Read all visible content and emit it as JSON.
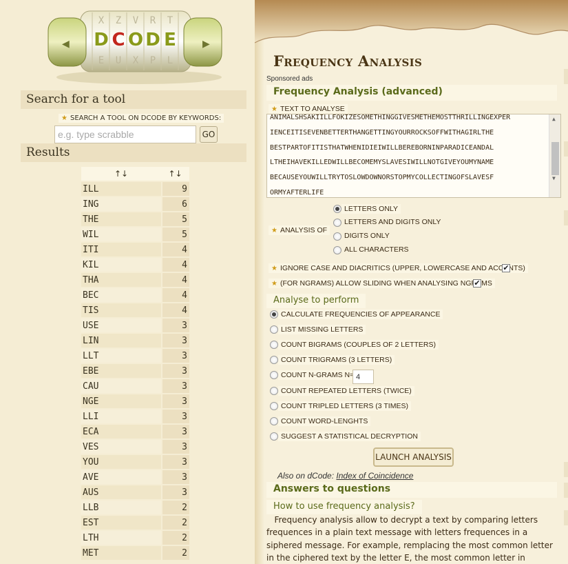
{
  "logo": {
    "name": "DCODE",
    "letters": [
      "D",
      "C",
      "O",
      "D",
      "E"
    ]
  },
  "sidebar": {
    "search_heading": "Search for a tool",
    "search_label": "SEARCH A TOOL ON DCODE BY KEYWORDS:",
    "search_placeholder": "e.g. type scrabble",
    "go_label": "GO",
    "results_heading": "Results",
    "sort_glyph": "↑↓",
    "rows": [
      {
        "ngram": "ILL",
        "count": "9"
      },
      {
        "ngram": "ING",
        "count": "6"
      },
      {
        "ngram": "THE",
        "count": "5"
      },
      {
        "ngram": "WIL",
        "count": "5"
      },
      {
        "ngram": "ITI",
        "count": "4"
      },
      {
        "ngram": "KIL",
        "count": "4"
      },
      {
        "ngram": "THA",
        "count": "4"
      },
      {
        "ngram": "BEC",
        "count": "4"
      },
      {
        "ngram": "TIS",
        "count": "4"
      },
      {
        "ngram": "USE",
        "count": "3"
      },
      {
        "ngram": "LIN",
        "count": "3"
      },
      {
        "ngram": "LLT",
        "count": "3"
      },
      {
        "ngram": "EBE",
        "count": "3"
      },
      {
        "ngram": "CAU",
        "count": "3"
      },
      {
        "ngram": "NGE",
        "count": "3"
      },
      {
        "ngram": "LLI",
        "count": "3"
      },
      {
        "ngram": "ECA",
        "count": "3"
      },
      {
        "ngram": "VES",
        "count": "3"
      },
      {
        "ngram": "YOU",
        "count": "3"
      },
      {
        "ngram": "AVE",
        "count": "3"
      },
      {
        "ngram": "AUS",
        "count": "3"
      },
      {
        "ngram": "LLB",
        "count": "2"
      },
      {
        "ngram": "EST",
        "count": "2"
      },
      {
        "ngram": "LTH",
        "count": "2"
      },
      {
        "ngram": "MET",
        "count": "2"
      }
    ]
  },
  "main": {
    "title": "Frequency Analysis",
    "sponsored": "Sponsored ads",
    "tool_heading": "Frequency Analysis (advanced)",
    "text_label": "TEXT TO ANALYSE",
    "text_lines": [
      "ANIMALSHSAKIILLFOKIZESOMETHINGGIVESMETHEMOSTTHRILLINGEXPER",
      "IENCEITISEVENBETTERTHANGETTINGYOURROCKSOFFWITHAGIRLTHE",
      "BESTPARTOFITISTHATWHENIDIEIWILLBEREBORNINPARADICEANDAL",
      "LTHEIHAVEKILLEDWILLBECOMEMYSLAVESIWILLNOTGIVEYOUMYNAME",
      "BECAUSEYOUWILLTRYTOSLOWDOWNORSTOPMYCOLLECTINGOFSLAVESF",
      "ORMYAFTERLIFE"
    ],
    "analysis_of_label": "ANALYSIS OF",
    "analysis_options": [
      {
        "label": "LETTERS ONLY",
        "selected": true
      },
      {
        "label": "LETTERS AND DIGITS ONLY",
        "selected": false
      },
      {
        "label": "DIGITS ONLY",
        "selected": false
      },
      {
        "label": "ALL CHARACTERS",
        "selected": false
      }
    ],
    "ignore_case_label": "IGNORE CASE AND DIACRITICS (UPPER, LOWERCASE AND ACCENTS)",
    "sliding_label": "(FOR NGRAMS) ALLOW SLIDING WHEN ANALYSING NGRAMS",
    "check_glyph": "✔",
    "analyse_heading": "Analyse to perform",
    "perform_options": [
      {
        "label": "CALCULATE FREQUENCIES OF APPEARANCE",
        "selected": true
      },
      {
        "label": "LIST MISSING LETTERS",
        "selected": false
      },
      {
        "label": "COUNT BIGRAMS (COUPLES OF 2 LETTERS)",
        "selected": false
      },
      {
        "label": "COUNT TRIGRAMS (3 LETTERS)",
        "selected": false
      },
      {
        "label": "COUNT N-GRAMS N=",
        "selected": false
      },
      {
        "label": "COUNT REPEATED LETTERS (TWICE)",
        "selected": false
      },
      {
        "label": "COUNT TRIPLED LETTERS (3 TIMES)",
        "selected": false
      },
      {
        "label": "COUNT WORD-LENGHTS",
        "selected": false
      },
      {
        "label": "SUGGEST A STATISTICAL DECRYPTION",
        "selected": false
      }
    ],
    "ngram_n_value": "4",
    "launch_label": "LAUNCH ANALYSIS",
    "also_on_prefix": "Also on dCode:",
    "also_on_link": "Index of Coincidence",
    "answers_heading": "Answers to questions",
    "question_heading": "How to use frequency analysis?",
    "answer_text": "Frequency analysis allow to decrypt a text by comparing letters frequences in a plain text message with letters frequences in a siphered message. For example, remplacing the most common letter in the ciphered text by the letter E, the most common letter in English, and so"
  }
}
